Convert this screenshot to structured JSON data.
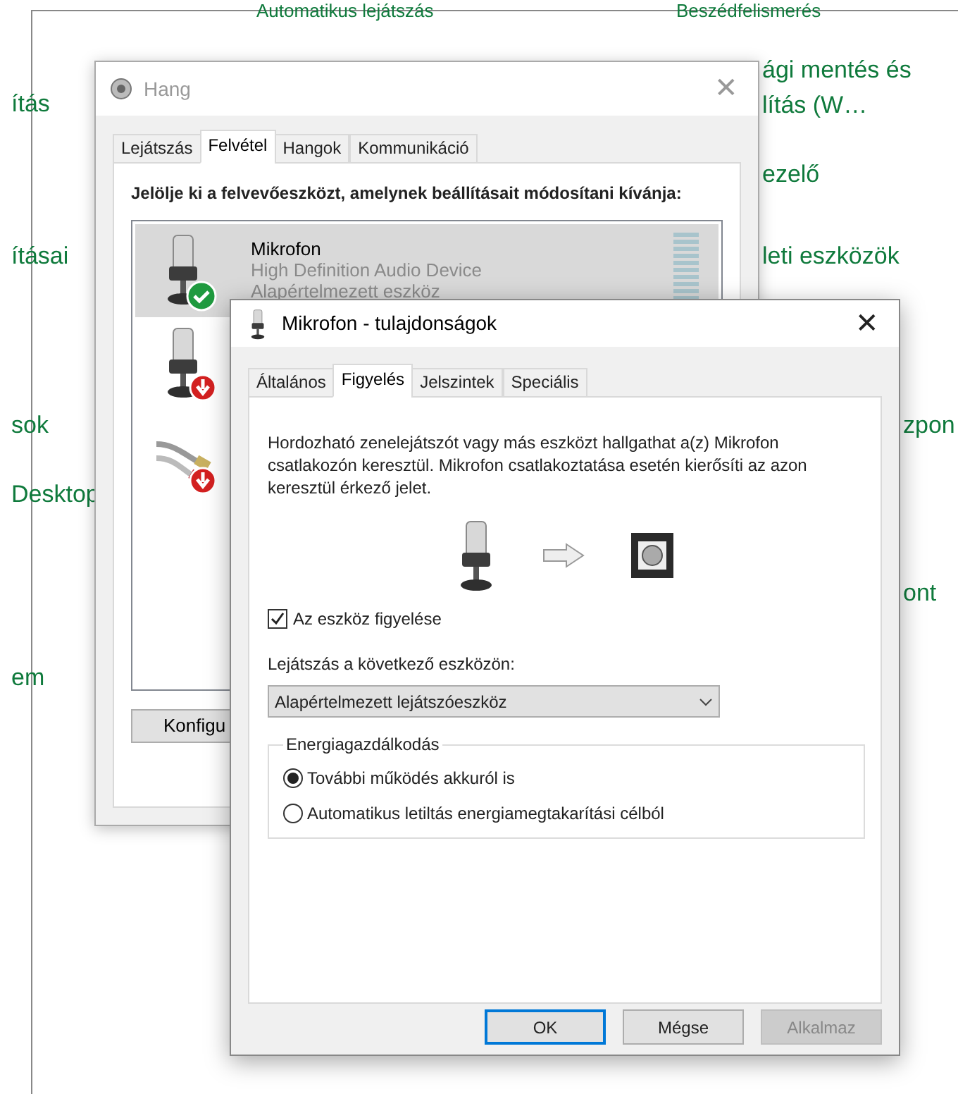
{
  "background": {
    "top_links": [
      "Automatikus lejátszás",
      "Beszédfelismerés"
    ],
    "left_links": [
      "ítás",
      "ításai",
      "sok",
      "Desktop",
      "em"
    ],
    "right_links": [
      "ági mentés és",
      "lítás (W…",
      "ezelő",
      "leti eszközök",
      "zpon",
      "ont"
    ]
  },
  "sound_window": {
    "title": "Hang",
    "close": "✕",
    "tabs": [
      {
        "label": "Lejátszás",
        "selected": false
      },
      {
        "label": "Felvétel",
        "selected": true
      },
      {
        "label": "Hangok",
        "selected": false
      },
      {
        "label": "Kommunikáció",
        "selected": false
      }
    ],
    "instruction": "Jelölje ki a felvevőeszközt, amelynek beállításait módosítani kívánja:",
    "devices": [
      {
        "kind": "microphone",
        "default": true,
        "connected": true,
        "selected": true,
        "name": "Mikrofon",
        "description": "High Definition Audio Device",
        "state_text": "Alapértelmezett eszköz",
        "level": 0
      },
      {
        "kind": "microphone",
        "default": false,
        "connected": false,
        "selected": false
      },
      {
        "kind": "line-in",
        "default": false,
        "connected": false,
        "selected": false
      }
    ],
    "configure_button": "Konfigu"
  },
  "properties_window": {
    "title": "Mikrofon - tulajdonságok",
    "close": "✕",
    "tabs": [
      {
        "label": "Általános",
        "selected": false
      },
      {
        "label": "Figyelés",
        "selected": true
      },
      {
        "label": "Jelszintek",
        "selected": false
      },
      {
        "label": "Speciális",
        "selected": false
      }
    ],
    "description": "Hordozható zenelejátszót vagy más eszközt hallgathat a(z) Mikrofon csatlakozón keresztül. Mikrofon csatlakoztatása esetén kierősíti az azon keresztül érkező jelet.",
    "listen_checkbox": {
      "label": "Az eszköz figyelése",
      "checked": true
    },
    "playback_label": "Lejátszás a következő eszközön:",
    "playback_select": {
      "value": "Alapértelmezett lejátszóeszköz"
    },
    "power_group": {
      "title": "Energiagazdálkodás",
      "options": [
        {
          "label": "További működés akkuról is",
          "selected": true
        },
        {
          "label": "Automatikus letiltás energiamegtakarítási célból",
          "selected": false
        }
      ]
    },
    "buttons": [
      {
        "label": "OK",
        "default": true,
        "disabled": false
      },
      {
        "label": "Mégse",
        "default": false,
        "disabled": false
      },
      {
        "label": "Alkalmaz",
        "default": false,
        "disabled": true
      }
    ]
  }
}
